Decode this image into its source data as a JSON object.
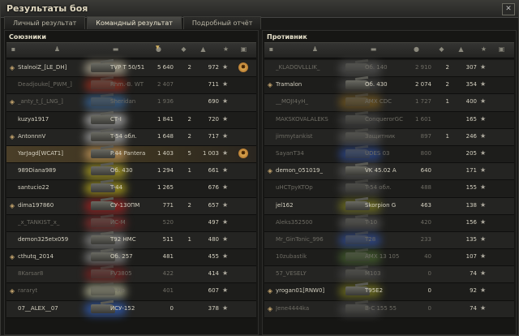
{
  "window": {
    "title": "Результаты боя",
    "close_glyph": "✕"
  },
  "tabs": [
    {
      "label": "Личный результат",
      "active": false
    },
    {
      "label": "Командный результат",
      "active": true
    },
    {
      "label": "Подробный отчёт",
      "active": false
    }
  ],
  "allies": {
    "title": "Союзники",
    "rows": [
      {
        "name": "StalnoiZ_[LE_DH]",
        "tank": "TVP T 50/51",
        "damage": "5 640",
        "kills": "2",
        "xp": "972",
        "platoon": true,
        "dead": false,
        "highlight": false,
        "medal": true,
        "tank_color": "#c0b8a0"
      },
      {
        "name": "Deadjouke[_PWM_]",
        "tank": "Rhm.-B. WT",
        "damage": "2 407",
        "kills": "",
        "xp": "711",
        "platoon": false,
        "dead": true,
        "highlight": false,
        "medal": false,
        "tank_color": "#a03020"
      },
      {
        "name": "_anty_t_[_LNG_]",
        "tank": "Sheridan",
        "damage": "1 936",
        "kills": "",
        "xp": "690",
        "platoon": true,
        "dead": true,
        "highlight": false,
        "medal": false,
        "tank_color": "#3a6aa0"
      },
      {
        "name": "kuzya1917",
        "tank": "СТ-I",
        "damage": "1 841",
        "kills": "2",
        "xp": "720",
        "platoon": false,
        "dead": false,
        "highlight": false,
        "medal": false,
        "tank_color": "#c0c0c0"
      },
      {
        "name": "AntonnnV",
        "tank": "T-54 обл.",
        "damage": "1 648",
        "kills": "2",
        "xp": "717",
        "platoon": true,
        "dead": false,
        "highlight": false,
        "medal": false,
        "tank_color": "#b0b0b0"
      },
      {
        "name": "YarJagd[WCAT1]",
        "tank": "P.44 Pantera",
        "damage": "1 403",
        "kills": "5",
        "xp": "1 003",
        "platoon": false,
        "dead": false,
        "highlight": true,
        "medal": true,
        "tank_color": "#d0a060"
      },
      {
        "name": "989Diana989",
        "tank": "Об. 430",
        "damage": "1 294",
        "kills": "1",
        "xp": "661",
        "platoon": false,
        "dead": false,
        "highlight": false,
        "medal": false,
        "tank_color": "#c0b020"
      },
      {
        "name": "santucio22",
        "tank": "T-44",
        "damage": "1 265",
        "kills": "",
        "xp": "676",
        "platoon": false,
        "dead": false,
        "highlight": false,
        "medal": false,
        "tank_color": "#c0b020"
      },
      {
        "name": "dima197860",
        "tank": "СУ-130ПМ",
        "damage": "771",
        "kills": "2",
        "xp": "657",
        "platoon": true,
        "dead": false,
        "highlight": false,
        "medal": false,
        "tank_color": "#b02020"
      },
      {
        "name": "_x_TANKIST_x_",
        "tank": "ИС-М",
        "damage": "520",
        "kills": "",
        "xp": "497",
        "platoon": false,
        "dead": true,
        "highlight": false,
        "medal": false,
        "tank_color": "#903030"
      },
      {
        "name": "demon325etx059",
        "tank": "T92 HMC",
        "damage": "511",
        "kills": "1",
        "xp": "480",
        "platoon": false,
        "dead": false,
        "highlight": false,
        "medal": false,
        "tank_color": "#909090"
      },
      {
        "name": "cthutq_2014",
        "tank": "Об. 257",
        "damage": "481",
        "kills": "",
        "xp": "455",
        "platoon": true,
        "dead": false,
        "highlight": false,
        "medal": false,
        "tank_color": "#909090"
      },
      {
        "name": "8Karsar8",
        "tank": "FV3805",
        "damage": "422",
        "kills": "",
        "xp": "414",
        "platoon": false,
        "dead": true,
        "highlight": false,
        "medal": false,
        "tank_color": "#802020"
      },
      {
        "name": "rararyt",
        "tank": "O-Ho",
        "damage": "401",
        "kills": "",
        "xp": "607",
        "platoon": true,
        "dead": true,
        "highlight": false,
        "medal": false,
        "tank_color": "#c0c0a0"
      },
      {
        "name": "07__ALEX__07",
        "tank": "ИСУ-152",
        "damage": "0",
        "kills": "",
        "xp": "378",
        "platoon": false,
        "dead": false,
        "highlight": false,
        "medal": false,
        "tank_color": "#3060c0"
      }
    ]
  },
  "enemies": {
    "title": "Противник",
    "rows": [
      {
        "name": "_KLADOVLLLIK_",
        "tank": "Об. 140",
        "damage": "2 910",
        "kills": "2",
        "xp": "307",
        "platoon": false,
        "dead": true,
        "tank_color": "#5a5a5a"
      },
      {
        "name": "Tramalon",
        "tank": "Об. 430",
        "damage": "2 074",
        "kills": "2",
        "xp": "354",
        "platoon": true,
        "dead": false,
        "tank_color": "#4a4a4a"
      },
      {
        "name": "__MOJI4yH_",
        "tank": "AMX CDC",
        "damage": "1 727",
        "kills": "1",
        "xp": "400",
        "platoon": false,
        "dead": true,
        "tank_color": "#806020"
      },
      {
        "name": "MAKSKOVALALEKS",
        "tank": "ConquerorGC",
        "damage": "1 601",
        "kills": "",
        "xp": "165",
        "platoon": false,
        "dead": true,
        "tank_color": "#4a4a4a"
      },
      {
        "name": "jimmytankist",
        "tank": "Защитник",
        "damage": "897",
        "kills": "1",
        "xp": "246",
        "platoon": false,
        "dead": true,
        "tank_color": "#5a5a5a"
      },
      {
        "name": "SayanT34",
        "tank": "UDES 03",
        "damage": "800",
        "kills": "",
        "xp": "205",
        "platoon": false,
        "dead": true,
        "tank_color": "#3050a0"
      },
      {
        "name": "demon_051019_",
        "tank": "VK 45.02 A",
        "damage": "640",
        "kills": "",
        "xp": "171",
        "platoon": true,
        "dead": false,
        "tank_color": "#5a5a5a"
      },
      {
        "name": "uHCTpyKTOp",
        "tank": "T-54 обл.",
        "damage": "488",
        "kills": "",
        "xp": "155",
        "platoon": false,
        "dead": true,
        "tank_color": "#4a4a4a"
      },
      {
        "name": "jel162",
        "tank": "Skorpion G",
        "damage": "463",
        "kills": "",
        "xp": "138",
        "platoon": false,
        "dead": false,
        "tank_color": "#808020"
      },
      {
        "name": "Aleks352500",
        "tank": "T-10",
        "damage": "420",
        "kills": "",
        "xp": "156",
        "platoon": false,
        "dead": true,
        "tank_color": "#5a5a5a"
      },
      {
        "name": "Mr_GinTonic_996",
        "tank": "T28",
        "damage": "233",
        "kills": "",
        "xp": "135",
        "platoon": false,
        "dead": true,
        "tank_color": "#3050a0"
      },
      {
        "name": "10zubastik",
        "tank": "AMX 13 105",
        "damage": "40",
        "kills": "",
        "xp": "107",
        "platoon": false,
        "dead": true,
        "tank_color": "#4a6a30"
      },
      {
        "name": "57_VESELY",
        "tank": "M103",
        "damage": "0",
        "kills": "",
        "xp": "74",
        "platoon": false,
        "dead": true,
        "tank_color": "#4a4a4a"
      },
      {
        "name": "yrogan01[RNW0]",
        "tank": "T95E2",
        "damage": "0",
        "kills": "",
        "xp": "92",
        "platoon": true,
        "dead": false,
        "tank_color": "#808020"
      },
      {
        "name": "Jene4444ka",
        "tank": "B-C 155 55",
        "damage": "0",
        "kills": "",
        "xp": "74",
        "platoon": true,
        "dead": true,
        "tank_color": "#4a4a4a"
      }
    ]
  },
  "icons": {
    "header": [
      "platoon-icon",
      "player-icon",
      "tank-icon",
      "damage-icon",
      "kills-icon",
      "xp-icon",
      "medal-icon"
    ],
    "row": [
      "platoon-icon",
      "star-icon",
      "achievement-medal-icon"
    ]
  }
}
